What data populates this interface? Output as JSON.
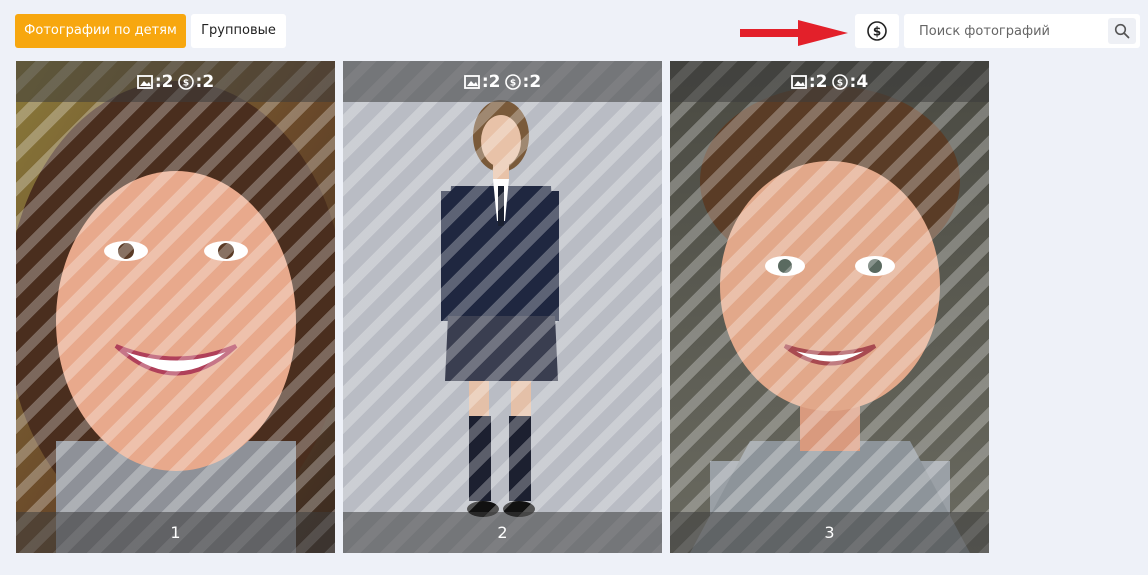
{
  "tabs": {
    "children_label": "Фотографии по детям",
    "group_label": "Групповые"
  },
  "price_button": {
    "icon": "dollar-circle-icon"
  },
  "search": {
    "placeholder": "Поиск фотографий",
    "icon": "search-icon"
  },
  "annotation": {
    "arrow_color": "#e3202a",
    "icon": "red-arrow-icon"
  },
  "colors": {
    "accent": "#f7a70f",
    "background": "#eef1f8"
  },
  "photos": [
    {
      "number": "1",
      "photos_count": "2",
      "price_count": "2",
      "description": "girl-smiling-portrait"
    },
    {
      "number": "2",
      "photos_count": "2",
      "price_count": "2",
      "description": "girl-school-uniform"
    },
    {
      "number": "3",
      "photos_count": "2",
      "price_count": "4",
      "description": "boy-smiling-portrait"
    }
  ]
}
